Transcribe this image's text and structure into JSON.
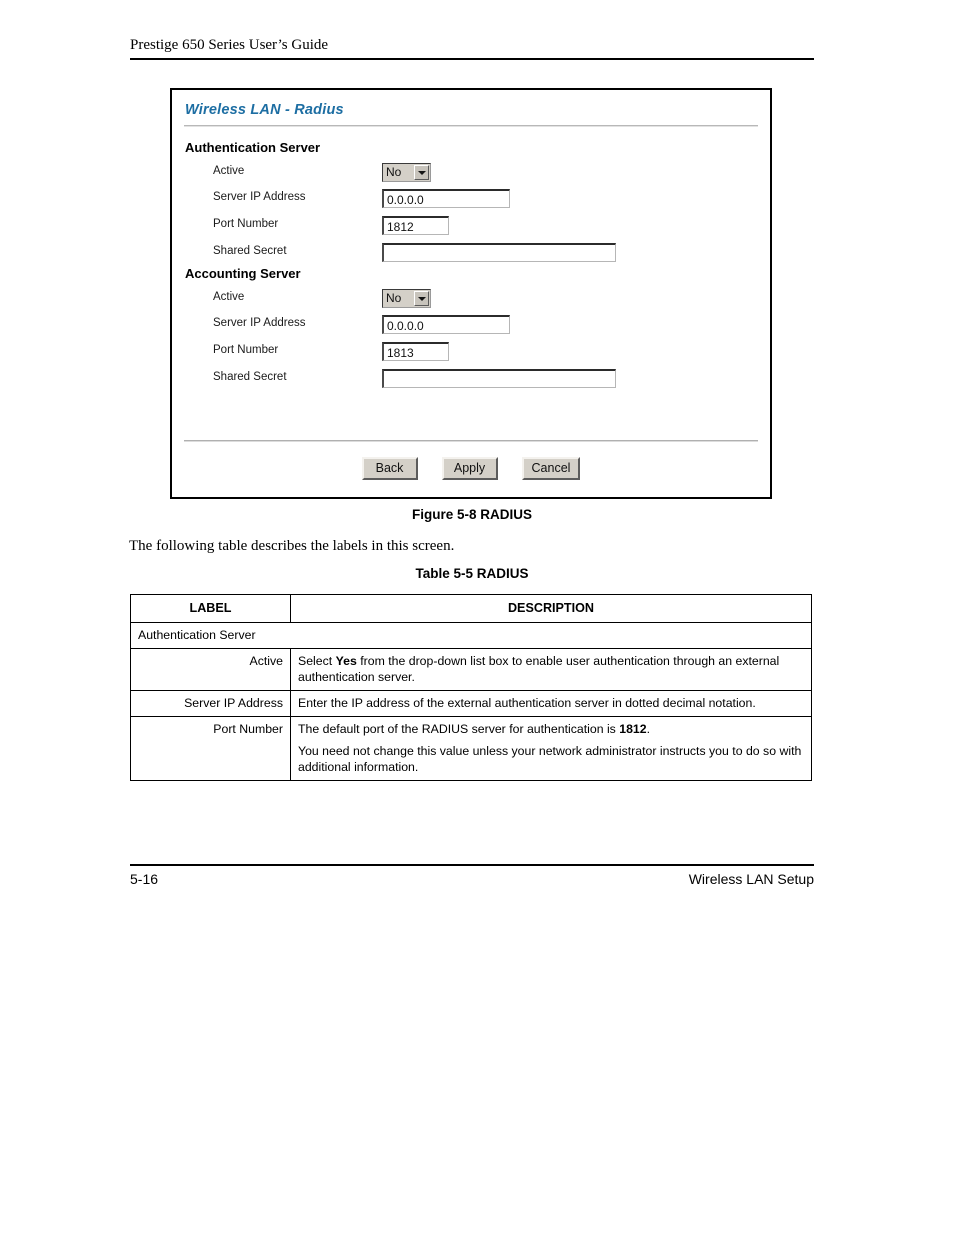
{
  "page": {
    "header_title": "Prestige 650 Series User’s Guide",
    "footer_left": "5-16",
    "footer_right": "Wireless LAN Setup"
  },
  "screenshot": {
    "title": "Wireless LAN - Radius",
    "groups": [
      {
        "heading": "Authentication Server",
        "fields": [
          {
            "label": "Active",
            "type": "select",
            "value": "No"
          },
          {
            "label": "Server IP Address",
            "type": "text",
            "value": "0.0.0.0"
          },
          {
            "label": "Port Number",
            "type": "text",
            "value": "1812"
          },
          {
            "label": "Shared Secret",
            "type": "text",
            "value": ""
          }
        ]
      },
      {
        "heading": "Accounting Server",
        "fields": [
          {
            "label": "Active",
            "type": "select",
            "value": "No"
          },
          {
            "label": "Server IP Address",
            "type": "text",
            "value": "0.0.0.0"
          },
          {
            "label": "Port Number",
            "type": "text",
            "value": "1813"
          },
          {
            "label": "Shared Secret",
            "type": "text",
            "value": ""
          }
        ]
      }
    ],
    "buttons": {
      "back": "Back",
      "apply": "Apply",
      "cancel": "Cancel"
    },
    "colors": {
      "title": "#1d6ea3",
      "control_face": "#d4d0c8"
    }
  },
  "figure": {
    "caption": "Figure 5-8 RADIUS"
  },
  "body": {
    "intro": "The following table describes the labels in this screen."
  },
  "table": {
    "caption": "Table 5-5 RADIUS",
    "headers": {
      "label": "LABEL",
      "description": "DESCRIPTION"
    },
    "rows": [
      {
        "kind": "section",
        "label": "Authentication Server"
      },
      {
        "kind": "item",
        "label": "Active",
        "paragraphs": [
          {
            "pre": "Select ",
            "bold": "Yes",
            "post": " from the drop-down list box to enable user authentication through an external authentication server."
          }
        ]
      },
      {
        "kind": "item",
        "label": "Server IP Address",
        "paragraphs": [
          {
            "pre": "Enter the IP address of the external authentication server in dotted decimal notation.",
            "bold": "",
            "post": ""
          }
        ]
      },
      {
        "kind": "item",
        "label": "Port Number",
        "paragraphs": [
          {
            "pre": "The default port of the RADIUS server for authentication is ",
            "bold": "1812",
            "post": "."
          },
          {
            "pre": "You need not change this value unless your network administrator instructs you to do so with additional information.",
            "bold": "",
            "post": ""
          }
        ]
      }
    ]
  }
}
